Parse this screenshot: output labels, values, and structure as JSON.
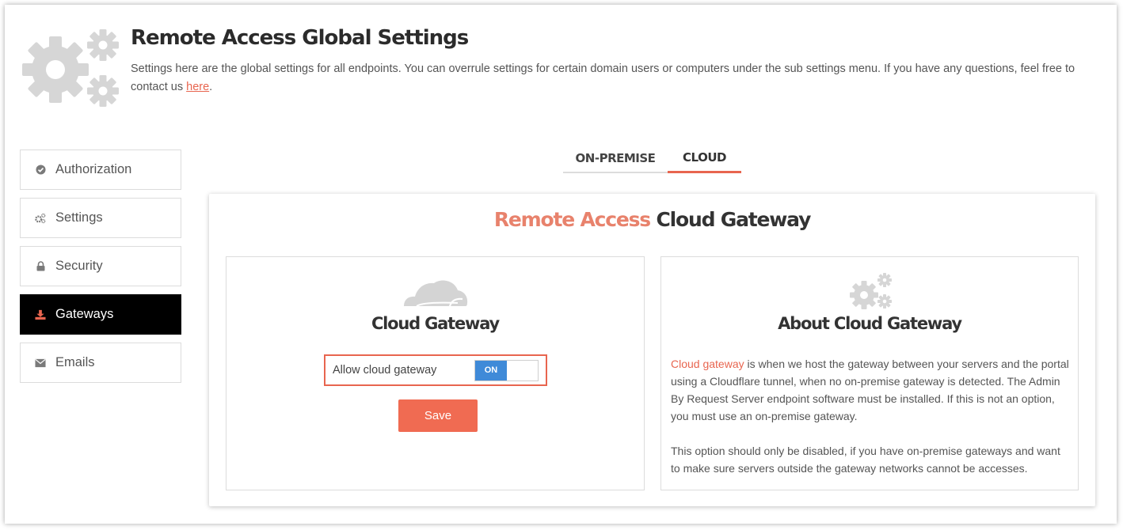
{
  "header": {
    "title": "Remote Access Global Settings",
    "description": "Settings here are the global settings for all endpoints. You can overrule settings for certain domain users or computers under the sub settings menu. If you have any questions, feel free to contact us ",
    "contact_link": "here",
    "description_end": "."
  },
  "sidebar": {
    "items": [
      {
        "label": "Authorization",
        "icon": "check-circle-icon",
        "active": false
      },
      {
        "label": "Settings",
        "icon": "gears-icon",
        "active": false
      },
      {
        "label": "Security",
        "icon": "lock-icon",
        "active": false
      },
      {
        "label": "Gateways",
        "icon": "download-icon",
        "active": true
      },
      {
        "label": "Emails",
        "icon": "envelope-icon",
        "active": false
      }
    ]
  },
  "tabs": [
    {
      "label": "ON-PREMISE",
      "active": false
    },
    {
      "label": "CLOUD",
      "active": true
    }
  ],
  "card": {
    "title_accent": "Remote Access",
    "title_rest": " Cloud Gateway",
    "left_panel": {
      "heading": "Cloud Gateway",
      "toggle_label": "Allow cloud gateway",
      "toggle_state": "ON",
      "save_label": "Save"
    },
    "right_panel": {
      "heading": "About Cloud Gateway",
      "highlight": "Cloud gateway",
      "paragraph1_rest": " is when we host the gateway between your servers and the portal using a Cloudflare tunnel, when no on-premise gateway is detected. The Admin By Request Server endpoint software must be installed. If this is not an option, you must use an on-premise gateway.",
      "paragraph2": "This option should only be disabled, if you have on-premise gateways and want to make sure servers outside the gateway networks cannot be accesses."
    }
  },
  "colors": {
    "accent": "#e8654f",
    "toggle_on": "#3f8ad8",
    "active_nav": "#000000",
    "icon_gray": "#d5d5d5"
  }
}
